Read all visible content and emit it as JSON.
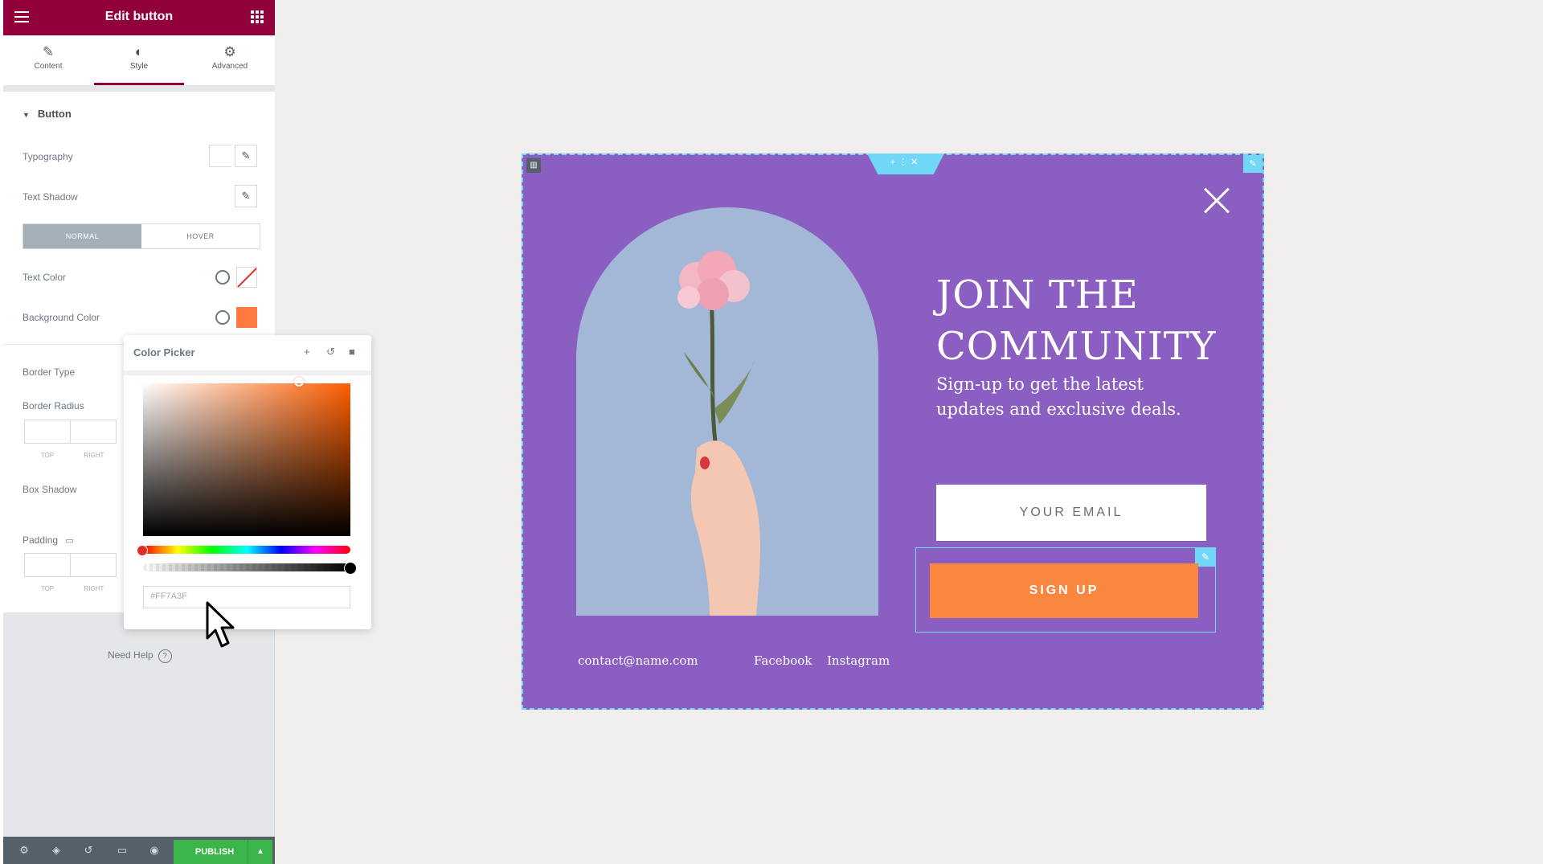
{
  "panel": {
    "title": "Edit button",
    "tabs": [
      {
        "label": "Content",
        "icon": "pencil-icon"
      },
      {
        "label": "Style",
        "icon": "contrast-icon"
      },
      {
        "label": "Advanced",
        "icon": "gear-icon"
      }
    ],
    "active_tab": "Style",
    "section_title": "Button",
    "rows": {
      "typography": "Typography",
      "text_shadow": "Text Shadow",
      "text_color": "Text Color",
      "background_color": "Background Color",
      "border_type": "Border Type",
      "border_radius": "Border Radius",
      "box_shadow": "Box Shadow",
      "padding": "Padding"
    },
    "state_toggle": {
      "normal": "NORMAL",
      "hover": "HOVER",
      "active": "NORMAL"
    },
    "dim_labels": [
      "TOP",
      "RIGHT"
    ],
    "need_help": "Need Help",
    "publish_label": "PUBLISH",
    "background_swatch_color": "#FF7A3F"
  },
  "color_picker": {
    "title": "Color Picker",
    "hex_value": "#FF7A3F"
  },
  "popup": {
    "headline_line1": "JOIN THE",
    "headline_line2": "COMMUNITY",
    "subtext": "Sign-up to get the latest updates and exclusive deals.",
    "email_placeholder": "YOUR EMAIL",
    "button_label": "SIGN UP",
    "contact_email": "contact@name.com",
    "facebook": "Facebook",
    "instagram": "Instagram",
    "background_color": "#8B5EC1",
    "button_color": "#F9873F"
  }
}
